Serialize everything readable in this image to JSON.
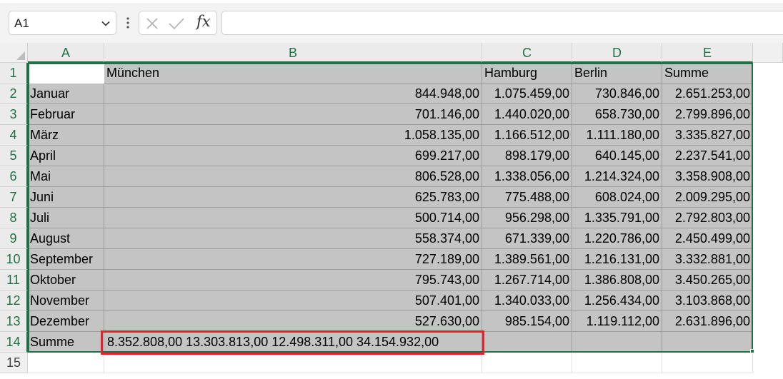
{
  "name_box": {
    "value": "A1"
  },
  "formula_bar": {
    "fx_label": "fx",
    "value": ""
  },
  "columns": [
    "A",
    "B",
    "C",
    "D",
    "E"
  ],
  "rows": [
    "1",
    "2",
    "3",
    "4",
    "5",
    "6",
    "7",
    "8",
    "9",
    "10",
    "11",
    "12",
    "13",
    "14",
    "15"
  ],
  "header_row": [
    "",
    "München",
    "Hamburg",
    "Berlin",
    "Summe"
  ],
  "data_rows": [
    [
      "Januar",
      "844.948,00",
      "1.075.459,00",
      "730.846,00",
      "2.651.253,00"
    ],
    [
      "Februar",
      "701.146,00",
      "1.440.020,00",
      "658.730,00",
      "2.799.896,00"
    ],
    [
      "März",
      "1.058.135,00",
      "1.166.512,00",
      "1.111.180,00",
      "3.335.827,00"
    ],
    [
      "April",
      "699.217,00",
      "898.179,00",
      "640.145,00",
      "2.237.541,00"
    ],
    [
      "Mai",
      "806.528,00",
      "1.338.056,00",
      "1.214.324,00",
      "3.358.908,00"
    ],
    [
      "Juni",
      "625.783,00",
      "775.488,00",
      "608.024,00",
      "2.009.295,00"
    ],
    [
      "Juli",
      "500.714,00",
      "956.298,00",
      "1.335.791,00",
      "2.792.803,00"
    ],
    [
      "August",
      "558.374,00",
      "671.339,00",
      "1.220.786,00",
      "2.450.499,00"
    ],
    [
      "September",
      "727.189,00",
      "1.389.561,00",
      "1.216.131,00",
      "3.332.881,00"
    ],
    [
      "Oktober",
      "795.743,00",
      "1.267.714,00",
      "1.386.808,00",
      "3.450.265,00"
    ],
    [
      "November",
      "507.401,00",
      "1.340.033,00",
      "1.256.434,00",
      "3.103.868,00"
    ],
    [
      "Dezember",
      "527.630,00",
      "985.154,00",
      "1.119.112,00",
      "2.631.896,00"
    ]
  ],
  "sum_row": {
    "label": "Summe",
    "b_text": "8.352.808,00 13.303.813,00 12.498.311,00 34.154.932,00"
  },
  "colors": {
    "selection_border": "#1f7145",
    "highlight": "#e32229",
    "selected_fill": "#c4c4c4"
  }
}
